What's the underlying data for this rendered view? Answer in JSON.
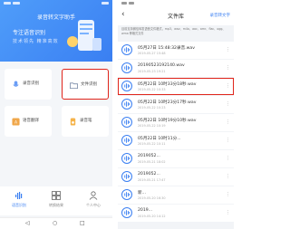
{
  "colors": {
    "brand": "#3a7ff2",
    "highlight": "#e0241a",
    "bg": "#f4f6f9"
  },
  "left": {
    "header": {
      "title": "录音转文字助手",
      "slogan": "专注语音识别",
      "tagline": "技术领先 精准高效"
    },
    "tiles": [
      {
        "label": "录音识别",
        "icon": "microphone-icon"
      },
      {
        "label": "文件识别",
        "icon": "folder-icon"
      },
      {
        "label": "语音翻译",
        "icon": "translate-icon"
      },
      {
        "label": "录音笔",
        "icon": "recorder-icon"
      }
    ],
    "nav": [
      {
        "label": "语音识别",
        "icon": "voice-icon"
      },
      {
        "label": "转换结果",
        "icon": "grid-icon"
      },
      {
        "label": "个人中心",
        "icon": "profile-icon"
      }
    ]
  },
  "right": {
    "header": {
      "back": "‹",
      "title": "文件库",
      "action": "录音转文字"
    },
    "hint": "目前支持微信转发语音文件格式，mp3、wav、m4a、aac、amr、flac、ogg、wma 等格式文件",
    "files": [
      {
        "name": "05月27日 15:48:32录音.wav",
        "meta": "2019-05-27 15:48"
      },
      {
        "name": "20190523192140.wav",
        "meta": "2019-05-23 19:21"
      },
      {
        "name": "05月22日 10时33分18秒.wav",
        "meta": "2019-05-22 10:33"
      },
      {
        "name": "05月22日 10时23分17秒.wav",
        "meta": "2019-05-22 10:23"
      },
      {
        "name": "05月22日 10时19分10秒.wav",
        "meta": "2019-05-22 10:19"
      },
      {
        "name": "05月22日 10时11分...",
        "meta": "2019-05-22 10:11"
      },
      {
        "name": "2019052...",
        "meta": "2019-05-21 18:02"
      },
      {
        "name": "2019052...",
        "meta": "2019-05-21 17:47"
      },
      {
        "name": "新...",
        "meta": "2019-05-20 16:30"
      },
      {
        "name": "2019...",
        "meta": "2019-05-20 14:12"
      }
    ],
    "selected_index": 2
  }
}
